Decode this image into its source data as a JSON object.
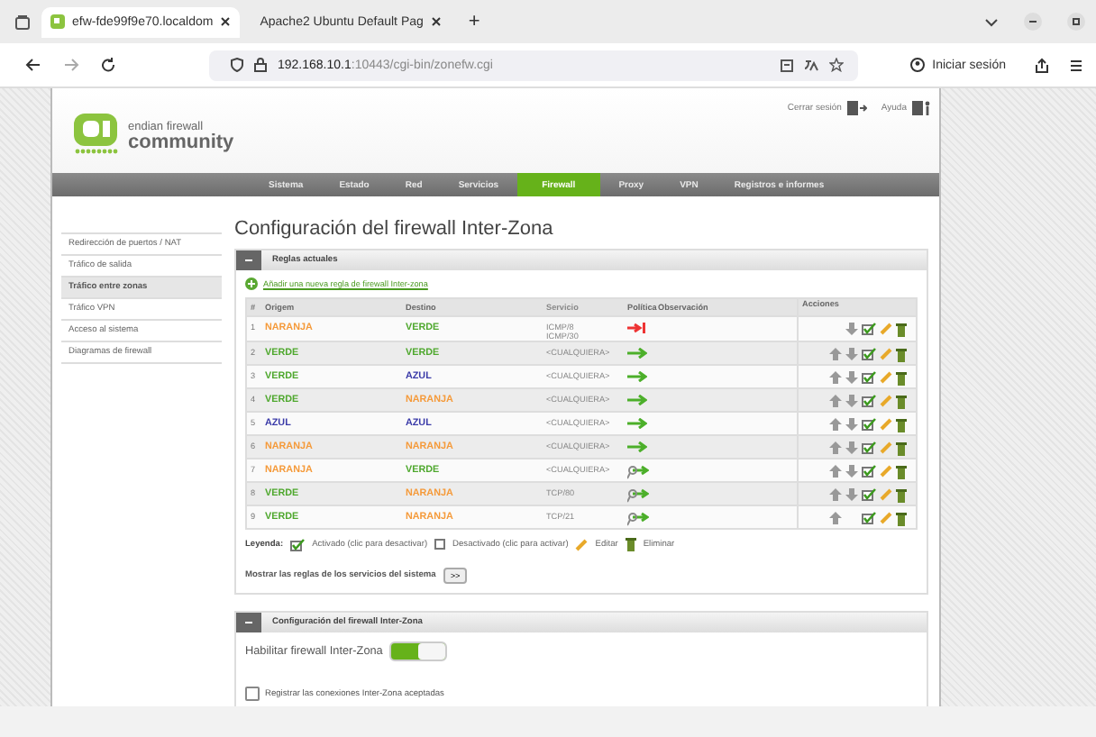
{
  "browser": {
    "tabs": [
      {
        "title": "efw-fde99f9e70.localdom",
        "selected": true
      },
      {
        "title": "Apache2 Ubuntu Default Pag",
        "selected": false
      }
    ],
    "new_tab": "+",
    "url_host": "192.168.10.1",
    "url_rest": ":10443/cgi-bin/zonefw.cgi",
    "signin": "Iniciar sesión"
  },
  "header": {
    "logo_small": "endian firewall",
    "logo_big": "community",
    "logout": "Cerrar sesión",
    "help": "Ayuda"
  },
  "nav": [
    {
      "label": "Sistema",
      "selected": false
    },
    {
      "label": "Estado",
      "selected": false
    },
    {
      "label": "Red",
      "selected": false
    },
    {
      "label": "Servicios",
      "selected": false
    },
    {
      "label": "Firewall",
      "selected": true
    },
    {
      "label": "Proxy",
      "selected": false
    },
    {
      "label": "VPN",
      "selected": false
    },
    {
      "label": "Registros e informes",
      "selected": false
    }
  ],
  "sidebar": [
    {
      "label": "Redirección de puertos / NAT",
      "selected": false
    },
    {
      "label": "Tráfico de salida",
      "selected": false
    },
    {
      "label": "Tráfico entre zonas",
      "selected": true
    },
    {
      "label": "Tráfico VPN",
      "selected": false
    },
    {
      "label": "Acceso al sistema",
      "selected": false
    },
    {
      "label": "Diagramas de firewall",
      "selected": false
    }
  ],
  "title": "Configuración del firewall Inter-Zona",
  "rules_panel": {
    "title": "Reglas actuales",
    "add_link": "Añadir una nueva regla de firewall Inter-zona",
    "columns": [
      "#",
      "Origem",
      "Destino",
      "Servicio",
      "Política",
      "Observación",
      "Acciones"
    ],
    "rows": [
      {
        "num": "1",
        "origin": {
          "text": "NARANJA",
          "color": "#f59a3a"
        },
        "destination": {
          "text": "VERDE",
          "color": "#4fa82e"
        },
        "service": [
          "ICMP/8",
          "ICMP/30"
        ],
        "kind": "deny",
        "can_move_up": false,
        "can_move_down": true,
        "enabled": true
      },
      {
        "num": "2",
        "origin": {
          "text": "VERDE",
          "color": "#4fa82e"
        },
        "destination": {
          "text": "VERDE",
          "color": "#4fa82e"
        },
        "service": [
          "<CUALQUIERA>"
        ],
        "kind": "allow",
        "can_move_up": true,
        "can_move_down": true,
        "enabled": true
      },
      {
        "num": "3",
        "origin": {
          "text": "VERDE",
          "color": "#4fa82e"
        },
        "destination": {
          "text": "AZUL",
          "color": "#3a3aa8"
        },
        "service": [
          "<CUALQUIERA>"
        ],
        "kind": "allow",
        "can_move_up": true,
        "can_move_down": true,
        "enabled": true
      },
      {
        "num": "4",
        "origin": {
          "text": "VERDE",
          "color": "#4fa82e"
        },
        "destination": {
          "text": "NARANJA",
          "color": "#f59a3a"
        },
        "service": [
          "<CUALQUIERA>"
        ],
        "kind": "allow",
        "can_move_up": true,
        "can_move_down": true,
        "enabled": true
      },
      {
        "num": "5",
        "origin": {
          "text": "AZUL",
          "color": "#3a3aa8"
        },
        "destination": {
          "text": "AZUL",
          "color": "#3a3aa8"
        },
        "service": [
          "<CUALQUIERA>"
        ],
        "kind": "allow",
        "can_move_up": true,
        "can_move_down": true,
        "enabled": true
      },
      {
        "num": "6",
        "origin": {
          "text": "NARANJA",
          "color": "#f59a3a"
        },
        "destination": {
          "text": "NARANJA",
          "color": "#f59a3a"
        },
        "service": [
          "<CUALQUIERA>"
        ],
        "kind": "allow",
        "can_move_up": true,
        "can_move_down": true,
        "enabled": true
      },
      {
        "num": "7",
        "origin": {
          "text": "NARANJA",
          "color": "#f59a3a"
        },
        "destination": {
          "text": "VERDE",
          "color": "#4fa82e"
        },
        "service": [
          "<CUALQUIERA>"
        ],
        "kind": "allow_log",
        "can_move_up": true,
        "can_move_down": true,
        "enabled": true
      },
      {
        "num": "8",
        "origin": {
          "text": "VERDE",
          "color": "#4fa82e"
        },
        "destination": {
          "text": "NARANJA",
          "color": "#f59a3a"
        },
        "service": [
          "TCP/80"
        ],
        "kind": "allow_log",
        "can_move_up": true,
        "can_move_down": true,
        "enabled": true
      },
      {
        "num": "9",
        "origin": {
          "text": "VERDE",
          "color": "#4fa82e"
        },
        "destination": {
          "text": "NARANJA",
          "color": "#f59a3a"
        },
        "service": [
          "TCP/21"
        ],
        "kind": "allow_log",
        "can_move_up": true,
        "can_move_down": false,
        "enabled": true
      }
    ]
  },
  "legend": {
    "label": "Leyenda:",
    "enabled": "Activado (clic para desactivar)",
    "disabled": "Desactivado (clic para activar)",
    "edit": "Editar",
    "delete": "Eliminar"
  },
  "show_system": {
    "label": "Mostrar las reglas de los servicios del sistema",
    "button": ">>"
  },
  "config_panel": {
    "title": "Configuración del firewall Inter-Zona",
    "enable_label": "Habilitar firewall Inter-Zona",
    "enabled": true,
    "log_label": "Registrar las conexiones Inter-Zona aceptadas",
    "log_checked": false
  }
}
